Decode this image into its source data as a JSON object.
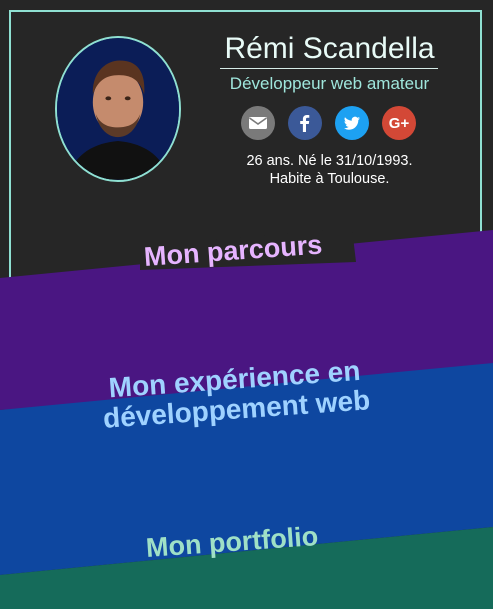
{
  "profile": {
    "name": "Rémi Scandella",
    "title": "Développeur web amateur",
    "bio_line1": "26 ans. Né le 31/10/1993.",
    "bio_line2": "Habite à Toulouse."
  },
  "socials": [
    {
      "icon": "mail-icon",
      "label": ""
    },
    {
      "icon": "facebook-icon",
      "label": ""
    },
    {
      "icon": "twitter-icon",
      "label": ""
    },
    {
      "icon": "google-plus-icon",
      "label": "G+"
    }
  ],
  "sections": {
    "parcours": "Mon parcours",
    "experience_line1": "Mon expérience en",
    "experience_line2": "développement web",
    "portfolio": "Mon portfolio"
  },
  "colors": {
    "accent": "#8fe0d2",
    "parcours_band": "#4a1682",
    "experience_band": "#0e47a0",
    "portfolio_band": "#156b5a"
  }
}
